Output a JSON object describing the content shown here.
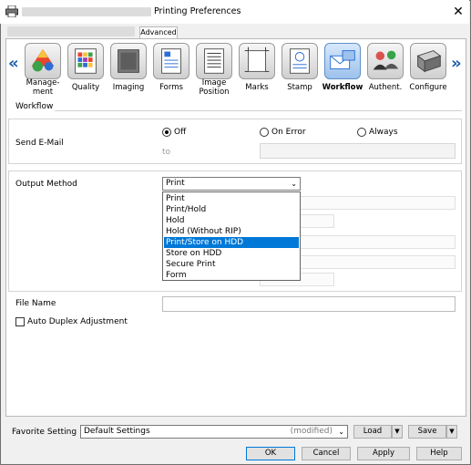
{
  "window": {
    "title": "Printing Preferences",
    "close_glyph": "✕"
  },
  "tabs": {
    "advanced": "Advanced"
  },
  "toolbar": {
    "items": [
      {
        "label": "Manage-\nment",
        "icon": "management-icon"
      },
      {
        "label": "Quality",
        "icon": "quality-icon"
      },
      {
        "label": "Imaging",
        "icon": "imaging-icon"
      },
      {
        "label": "Forms",
        "icon": "forms-icon"
      },
      {
        "label": "Image\nPosition",
        "icon": "image-position-icon"
      },
      {
        "label": "Marks",
        "icon": "marks-icon"
      },
      {
        "label": "Stamp",
        "icon": "stamp-icon"
      },
      {
        "label": "Workflow",
        "icon": "workflow-icon",
        "selected": true
      },
      {
        "label": "Authent.",
        "icon": "authentication-icon"
      },
      {
        "label": "Configure",
        "icon": "configure-icon"
      }
    ],
    "prev": "«",
    "next": "»"
  },
  "section_title": "Workflow",
  "send_email": {
    "label": "Send E-Mail",
    "options": [
      "Off",
      "On Error",
      "Always"
    ],
    "selected": "Off",
    "to_label": "to"
  },
  "output_method": {
    "label": "Output Method",
    "value": "Print",
    "options": [
      "Print",
      "Print/Hold",
      "Hold",
      "Hold (Without RIP)",
      "Print/Store on HDD",
      "Store on HDD",
      "Secure Print",
      "Form"
    ],
    "highlighted": "Print/Store on HDD"
  },
  "file_name": {
    "label": "File Name",
    "value": ""
  },
  "auto_duplex": {
    "label": "Auto Duplex Adjustment",
    "checked": false
  },
  "favorite": {
    "label": "Favorite Setting",
    "value": "Default Settings",
    "suffix": "(modified)",
    "load": "Load",
    "save": "Save"
  },
  "buttons": {
    "ok": "OK",
    "cancel": "Cancel",
    "apply": "Apply",
    "help": "Help"
  }
}
